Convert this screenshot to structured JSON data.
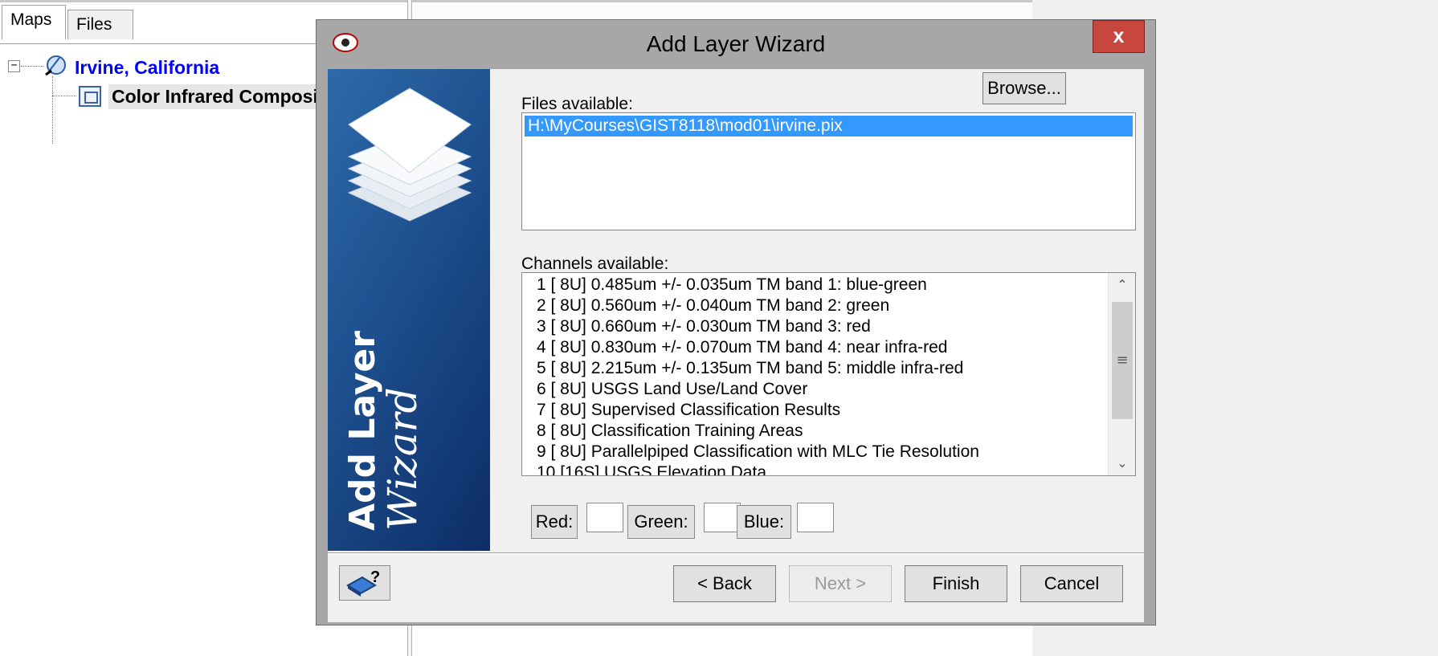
{
  "app": {
    "tabs": [
      {
        "label": "Maps"
      },
      {
        "label": "Files"
      }
    ],
    "tree": {
      "root_label": "Irvine, California",
      "child_label": "Color Infrared Composi"
    }
  },
  "dialog": {
    "title": "Add Layer Wizard",
    "close_label": "x",
    "banner": {
      "line1": "Add Layer",
      "line2": "Wizard"
    },
    "files": {
      "label": "Files available:",
      "browse_label": "Browse...",
      "items": [
        "H:\\MyCourses\\GIST8118\\mod01\\irvine.pix"
      ]
    },
    "channels": {
      "label": "Channels available:",
      "items": [
        "1 [ 8U] 0.485um +/- 0.035um  TM band 1: blue-green",
        "2 [ 8U] 0.560um +/- 0.040um  TM band 2: green",
        "3 [ 8U] 0.660um +/- 0.030um  TM band 3: red",
        "4 [ 8U] 0.830um +/- 0.070um  TM band 4: near infra-red",
        "5 [ 8U] 2.215um +/- 0.135um  TM band 5: middle infra-red",
        "6 [ 8U] USGS Land Use/Land Cover",
        "7 [ 8U] Supervised Classification Results",
        "8 [ 8U] Classification Training Areas",
        "9 [ 8U] Parallelpiped Classification with MLC Tie Resolution",
        "10 [16S] USGS Elevation Data"
      ]
    },
    "rgb": {
      "red_label": "Red:",
      "green_label": "Green:",
      "blue_label": "Blue:"
    },
    "buttons": {
      "back": "< Back",
      "next": "Next >",
      "finish": "Finish",
      "cancel": "Cancel"
    }
  },
  "colors": {
    "selection": "#3399ff",
    "banner_blue": "#1d4f8e",
    "close_red": "#c7463e",
    "tree_link": "#0000ff"
  }
}
